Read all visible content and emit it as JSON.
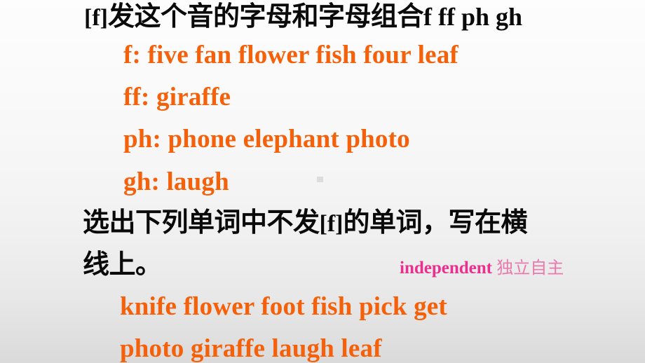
{
  "slide": {
    "background_top_color": "#fdfdfd",
    "background_bottom_color": "#dadada",
    "accent_orange": "#f5610a",
    "accent_pink_bold": "#ec2e8e",
    "accent_pink_light": "#e87aae",
    "text_black": "#0a0a0a"
  },
  "title_line": {
    "phonetic": "[f]",
    "chinese": "发这个音的字母和字母组合",
    "letters": "f  ff  ph gh"
  },
  "sound_rules": [
    {
      "key": "f:",
      "words": "f: five  fan  flower  fish  four  leaf"
    },
    {
      "key": "ff:",
      "words": "ff: giraffe"
    },
    {
      "key": "ph:",
      "words": "ph:  phone  elephant  photo"
    },
    {
      "key": "gh:",
      "words": "gh: laugh"
    }
  ],
  "instruction": {
    "part1": "选出下列单词中不发",
    "phonetic": "[f]",
    "part2": "的单词，写在横",
    "line2": "线上。"
  },
  "vocab_note": {
    "english": "independent",
    "chinese": "独立自主"
  },
  "word_bank": {
    "row1": "knife   flower   foot   fish   pick  get",
    "row2": "photo giraffe  laugh  leaf"
  },
  "artifact": {
    "name": "stray-gray-square"
  }
}
